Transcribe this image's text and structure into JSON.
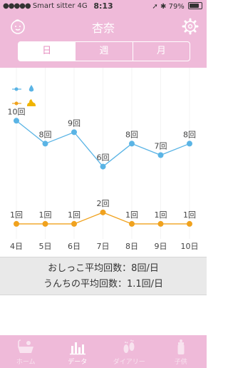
{
  "status_bar": {
    "carrier": "Smart sitter",
    "network": "4G",
    "time": "8:13",
    "battery": "79%"
  },
  "header": {
    "title": "杏奈",
    "left_icon": "baby-face-icon",
    "right_icon": "gear-icon"
  },
  "period_tabs": [
    {
      "label": "日",
      "selected": true
    },
    {
      "label": "週",
      "selected": false
    },
    {
      "label": "月",
      "selected": false
    }
  ],
  "colors": {
    "accent": "#efbad9",
    "pee": "#5ab4e5",
    "poop": "#f0a21e"
  },
  "chart_data": {
    "type": "line",
    "categories": [
      "4日",
      "5日",
      "6日",
      "7日",
      "8日",
      "9日",
      "10日"
    ],
    "series": [
      {
        "icon": "water-drop-icon",
        "values": [
          10,
          8,
          9,
          6,
          8,
          7,
          8
        ],
        "labels": [
          "10回",
          "8回",
          "9回",
          "6回",
          "8回",
          "7回",
          "8回"
        ],
        "color": "#5ab4e5"
      },
      {
        "icon": "poop-icon",
        "values": [
          1,
          1,
          1,
          2,
          1,
          1,
          1
        ],
        "labels": [
          "1回",
          "1回",
          "1回",
          "2回",
          "1回",
          "1回",
          "1回"
        ],
        "color": "#f0a21e"
      }
    ],
    "ylim": [
      0,
      14
    ],
    "grid": "vertical"
  },
  "summary": {
    "pee_average": "おしっこ平均回数：8回/日",
    "poop_average": "うんちの平均回数：1.1回/日"
  },
  "tab_bar": [
    {
      "label": "ホーム",
      "icon": "bath-icon",
      "active": false
    },
    {
      "label": "データ",
      "icon": "bar-chart-icon",
      "active": true
    },
    {
      "label": "ダイアリー",
      "icon": "footprints-icon",
      "active": false
    },
    {
      "label": "子供",
      "icon": "baby-bottle-icon",
      "active": false
    }
  ]
}
